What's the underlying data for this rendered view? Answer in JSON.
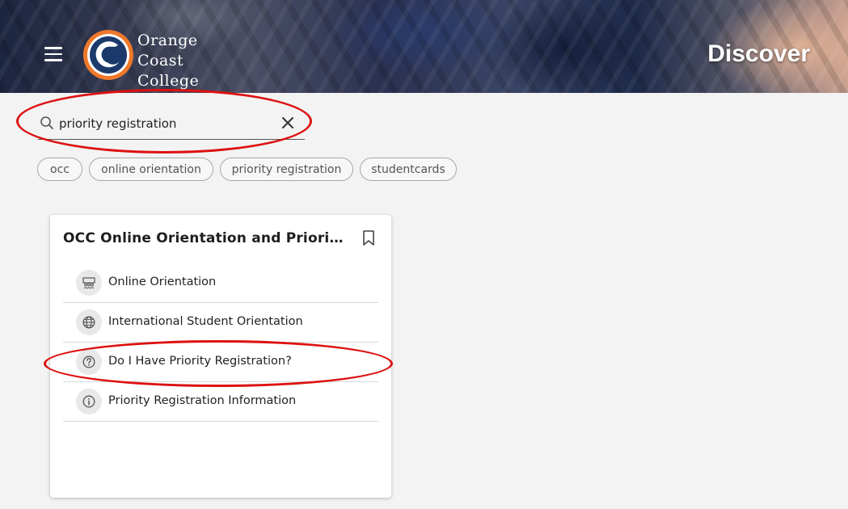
{
  "header": {
    "logo_lines": [
      "Orange",
      "Coast",
      "College"
    ],
    "page_title": "Discover",
    "brand_colors": {
      "orange": "#f0782a",
      "navy": "#1b3a6b"
    }
  },
  "search": {
    "value": "priority registration",
    "icon": "search-icon",
    "clear_icon": "close-icon"
  },
  "chips": [
    "occ",
    "online orientation",
    "priority registration",
    "studentcards"
  ],
  "card": {
    "title": "OCC Online Orientation and Priority Registration",
    "bookmark_icon": "bookmark-icon",
    "items": [
      {
        "label": "Online Orientation",
        "icon": "people-icon"
      },
      {
        "label": "International Student Orientation",
        "icon": "globe-icon"
      },
      {
        "label": "Do I Have Priority Registration?",
        "icon": "question-icon"
      },
      {
        "label": "Priority Registration Information",
        "icon": "info-icon"
      }
    ]
  },
  "annotation_color": "#dd1111"
}
